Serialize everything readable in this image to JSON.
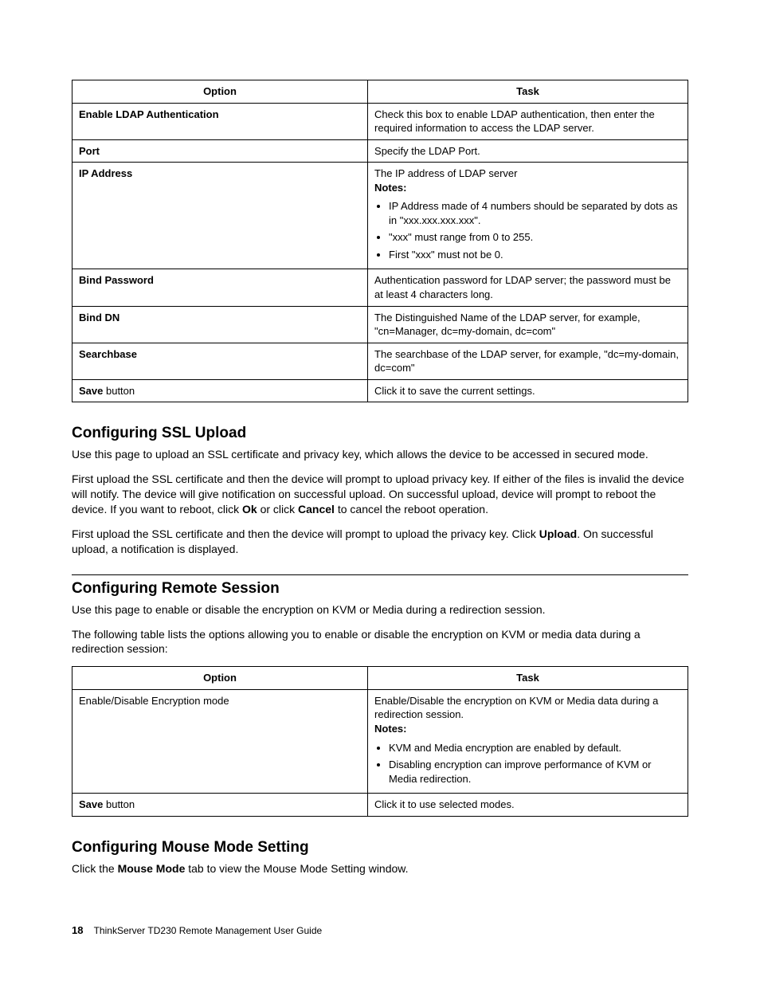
{
  "table1": {
    "head_option": "Option",
    "head_task": "Task",
    "rows": [
      {
        "option_bold": "Enable LDAP Authentication",
        "option_plain": "",
        "task_html": "Check this box to enable LDAP authentication, then enter the required information to access the LDAP server."
      },
      {
        "option_bold": "Port",
        "option_plain": "",
        "task_html": "Specify the LDAP Port."
      },
      {
        "option_bold": "IP Address",
        "option_plain": "",
        "task_intro": "The IP address of LDAP server",
        "task_notes_label": "Notes:",
        "task_notes": [
          "IP Address made of 4 numbers should be separated by dots as in \"xxx.xxx.xxx.xxx\".",
          "\"xxx\" must range from 0 to 255.",
          "First \"xxx\" must not be 0."
        ]
      },
      {
        "option_bold": "Bind Password",
        "option_plain": "",
        "task_html": "Authentication password for LDAP server; the password must be at least 4 characters long."
      },
      {
        "option_bold": "Bind DN",
        "option_plain": "",
        "task_html": "The Distinguished Name of the LDAP server, for example, \"cn=Manager, dc=my-domain, dc=com\""
      },
      {
        "option_bold": "Searchbase",
        "option_plain": "",
        "task_html": "The searchbase of the LDAP server, for example, \"dc=my-domain, dc=com\""
      },
      {
        "option_bold": "Save",
        "option_plain": " button",
        "task_html": "Click it to save the current settings."
      }
    ]
  },
  "ssl": {
    "heading": "Configuring SSL Upload",
    "p1": "Use this page to upload an SSL certificate and privacy key, which allows the device to be accessed in secured mode.",
    "p2_a": "First upload the SSL certificate and then the device will prompt to upload privacy key. If either of the files is invalid the device will notify. The device will give notification on successful upload. On successful upload, device will prompt to reboot the device. If you want to reboot, click ",
    "p2_ok": "Ok",
    "p2_b": " or click ",
    "p2_cancel": "Cancel",
    "p2_c": " to cancel the reboot operation.",
    "p3_a": "First upload the SSL certificate and then the device will prompt to upload the privacy key. Click ",
    "p3_upload": "Upload",
    "p3_b": ". On successful upload, a notification is displayed."
  },
  "remote": {
    "heading": "Configuring Remote Session",
    "p1": "Use this page to enable or disable the encryption on KVM or Media during a redirection session.",
    "p2": "The following table lists the options allowing you to enable or disable the encryption on KVM or media data during a redirection session:"
  },
  "table2": {
    "head_option": "Option",
    "head_task": "Task",
    "row1_option": "Enable/Disable Encryption mode",
    "row1_task_intro": "Enable/Disable the encryption on KVM or Media data during a redirection session.",
    "row1_notes_label": "Notes:",
    "row1_notes": [
      "KVM and Media encryption are enabled by default.",
      "Disabling encryption can improve performance of KVM or Media redirection."
    ],
    "row2_option_bold": "Save",
    "row2_option_plain": " button",
    "row2_task": "Click it to use selected modes."
  },
  "mouse": {
    "heading": "Configuring Mouse Mode Setting",
    "p_a": "Click the ",
    "p_bold": "Mouse Mode",
    "p_b": " tab to view the Mouse Mode Setting window."
  },
  "footer": {
    "page": "18",
    "title": "ThinkServer TD230 Remote Management User Guide"
  }
}
